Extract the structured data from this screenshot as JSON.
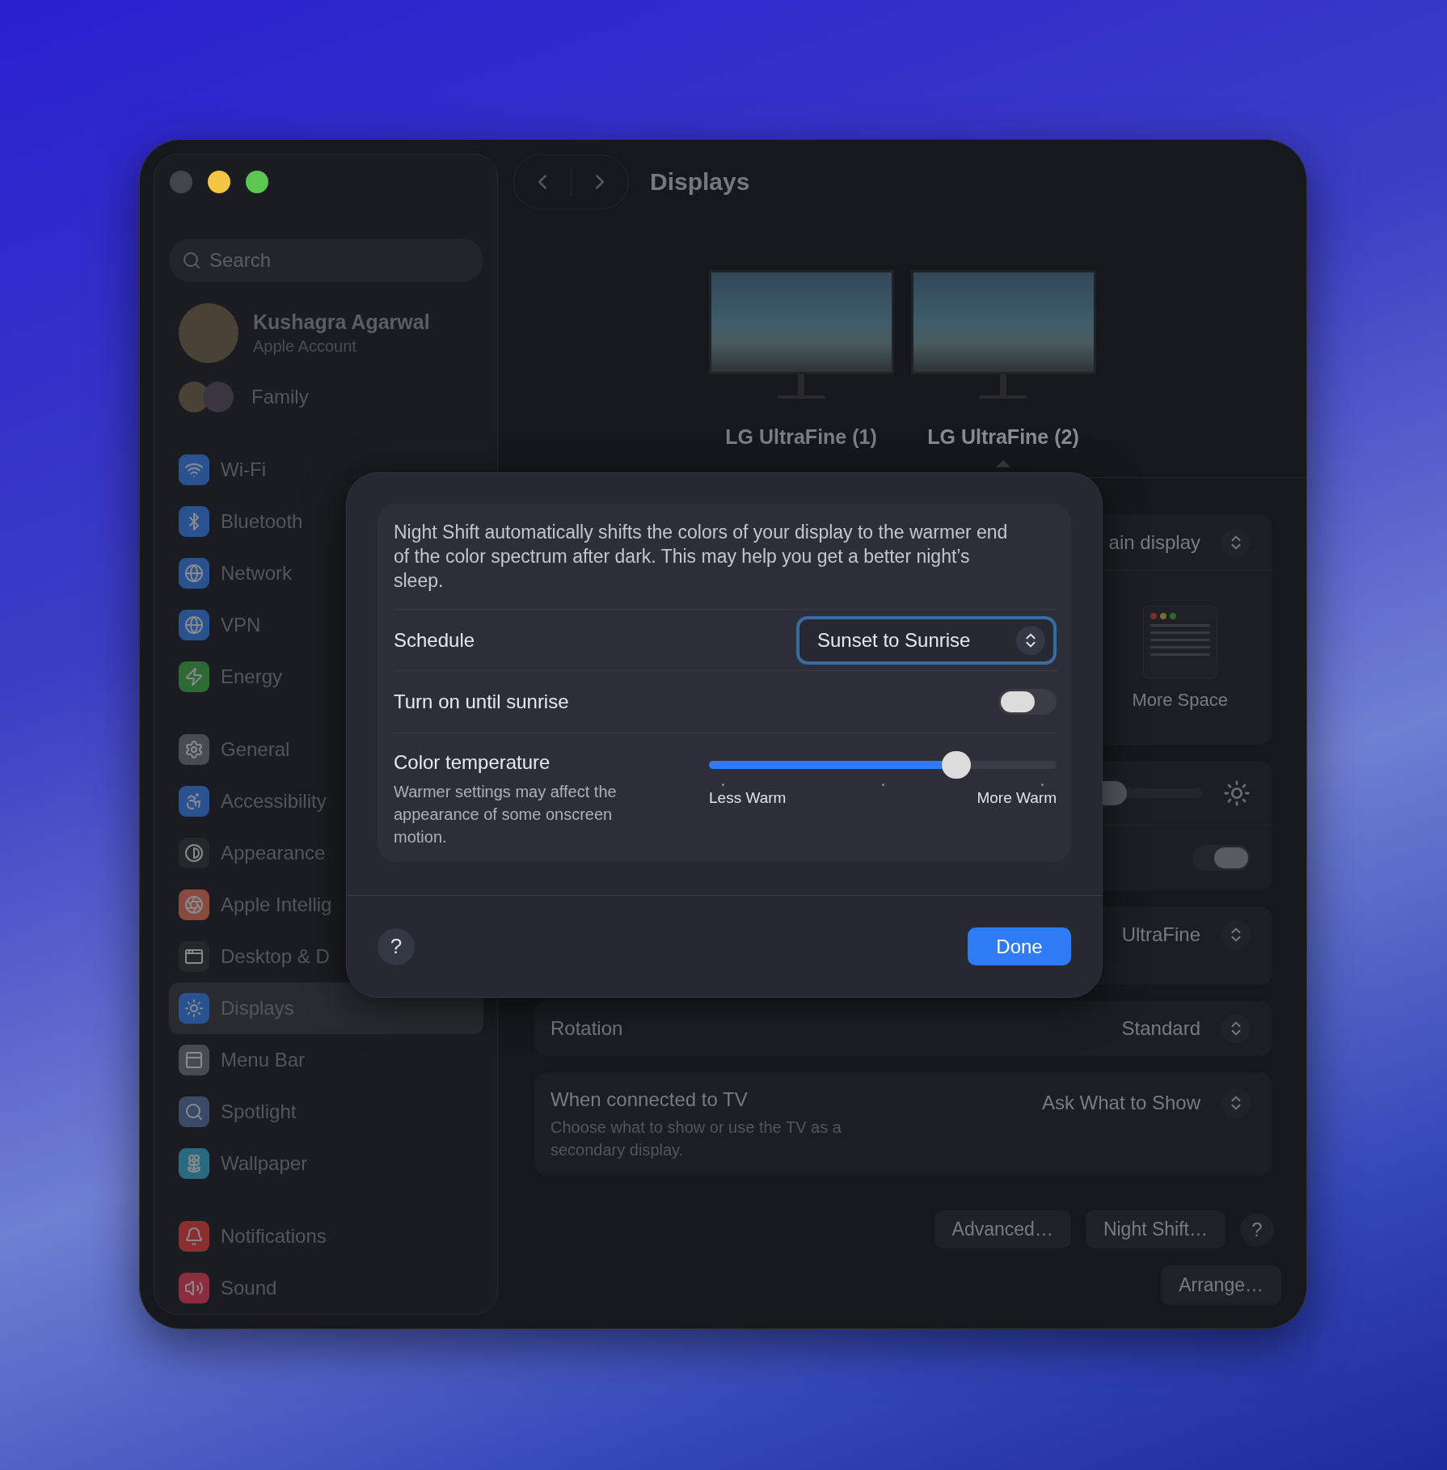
{
  "window": {
    "title": "Displays"
  },
  "sidebar": {
    "search": {
      "placeholder": "Search"
    },
    "account": {
      "name": "Kushagra Agarwal",
      "subtitle": "Apple Account"
    },
    "family": {
      "label": "Family"
    },
    "groups": [
      {
        "items": [
          {
            "label": "Wi-Fi",
            "color": "#2a5190",
            "selected": false
          },
          {
            "label": "Bluetooth",
            "color": "#2a5190",
            "selected": false
          },
          {
            "label": "Network",
            "color": "#2a5190",
            "selected": false
          },
          {
            "label": "VPN",
            "color": "#2a5190",
            "selected": false
          },
          {
            "label": "Energy",
            "color": "#2e6a34",
            "selected": false
          }
        ]
      },
      {
        "items": [
          {
            "label": "General",
            "color": "#4a4b50",
            "selected": false
          },
          {
            "label": "Accessibility",
            "color": "#2a5190",
            "selected": false
          },
          {
            "label": "Appearance",
            "color": "#26272b",
            "selected": false
          },
          {
            "label": "Apple Intellig",
            "color": "#8a4a3e",
            "selected": false
          },
          {
            "label": "Desktop & D",
            "color": "#26272b",
            "selected": false
          },
          {
            "label": "Displays",
            "color": "#2a5190",
            "selected": true
          },
          {
            "label": "Menu Bar",
            "color": "#4a4b50",
            "selected": false
          },
          {
            "label": "Spotlight",
            "color": "#3a4a66",
            "selected": false
          },
          {
            "label": "Wallpaper",
            "color": "#2a6a80",
            "selected": false
          }
        ]
      },
      {
        "items": [
          {
            "label": "Notifications",
            "color": "#8a2e2e",
            "selected": false
          },
          {
            "label": "Sound",
            "color": "#8a2e3e",
            "selected": false
          }
        ]
      }
    ]
  },
  "displays": [
    {
      "name": "LG UltraFine (1)",
      "selected": false
    },
    {
      "name": "LG UltraFine (2)",
      "selected": true
    }
  ],
  "settings": {
    "main_display_value": "ain display",
    "resolution_option": "More Space",
    "brightness": {
      "level": 0.0
    },
    "auto_toggle": {
      "on": true
    },
    "profile_value": "UltraFine",
    "rotation": {
      "label": "Rotation",
      "value": "Standard"
    },
    "tv": {
      "label": "When connected to TV",
      "description": "Choose what to show or use the TV as a secondary display.",
      "value": "Ask What to Show"
    },
    "buttons": [
      "Advanced…",
      "Night Shift…"
    ],
    "help": "?",
    "arrange": "Arrange…"
  },
  "sheet": {
    "description": "Night Shift automatically shifts the colors of your display to the warmer end of the color spectrum after dark. This may help you get a better night’s sleep.",
    "schedule": {
      "label": "Schedule",
      "value": "Sunset to Sunrise",
      "focused": true
    },
    "until_sunrise": {
      "label": "Turn on until sunrise",
      "on": false
    },
    "color_temperature": {
      "label": "Color temperature",
      "description": "Warmer settings may affect the appearance of some onscreen motion.",
      "level": 0.73,
      "min_label": "Less Warm",
      "max_label": "More Warm"
    },
    "help": "?",
    "done": "Done"
  }
}
